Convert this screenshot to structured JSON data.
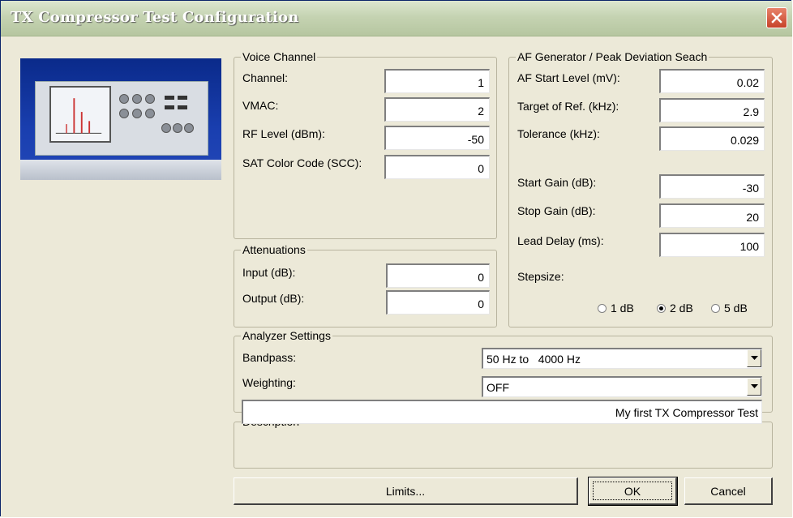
{
  "window": {
    "title": "TX Compressor Test Configuration"
  },
  "voice_channel": {
    "legend": "Voice Channel",
    "fields": [
      {
        "label": "Channel:",
        "value": "1"
      },
      {
        "label": "VMAC:",
        "value": "2"
      },
      {
        "label": "RF Level (dBm):",
        "value": "-50"
      },
      {
        "label": "SAT Color Code (SCC):",
        "value": "0"
      }
    ]
  },
  "attenuations": {
    "legend": "Attenuations",
    "fields": [
      {
        "label": "Input (dB):",
        "value": "0"
      },
      {
        "label": "Output (dB):",
        "value": "0"
      }
    ]
  },
  "af_generator": {
    "legend": "AF Generator / Peak Deviation Seach",
    "fields": [
      {
        "label": "AF Start Level (mV):",
        "value": "0.02"
      },
      {
        "label": "Target of Ref. (kHz):",
        "value": "2.9"
      },
      {
        "label": "Tolerance (kHz):",
        "value": "0.029"
      },
      {
        "label": "Start Gain (dB):",
        "value": "-30"
      },
      {
        "label": "Stop Gain (dB):",
        "value": "20"
      },
      {
        "label": "Lead Delay (ms):",
        "value": "100"
      }
    ],
    "stepsize_label": "Stepsize:",
    "stepsize_options": [
      "1 dB",
      "2 dB",
      "5 dB"
    ],
    "stepsize_selected": "2 dB"
  },
  "analyzer": {
    "legend": "Analyzer Settings",
    "bandpass_label": "Bandpass:",
    "bandpass_value": "50 Hz to   4000 Hz",
    "weighting_label": "Weighting:",
    "weighting_value": "OFF"
  },
  "description": {
    "legend": "Description",
    "value": "My first TX Compressor Test"
  },
  "buttons": {
    "limits": "Limits...",
    "ok": "OK",
    "cancel": "Cancel"
  },
  "icons": {
    "close": "close-icon",
    "dropdown": "chevron-down-icon",
    "device": "instrument-image"
  }
}
